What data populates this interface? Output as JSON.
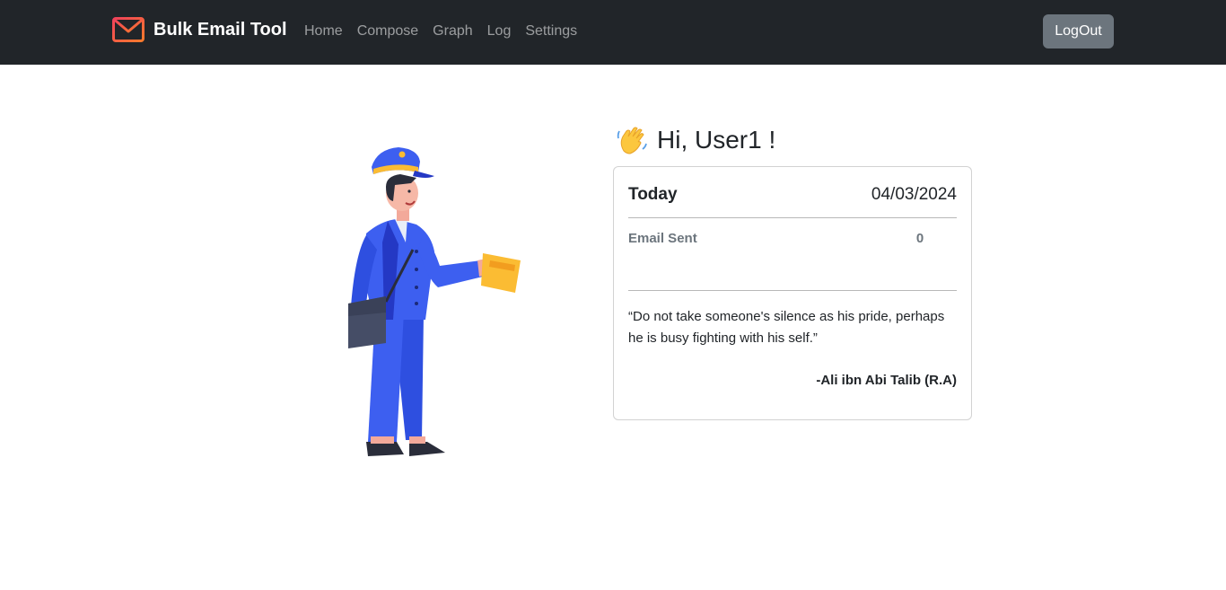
{
  "navbar": {
    "brand": "Bulk Email Tool",
    "brand_icon": "envelope-icon",
    "links": [
      {
        "label": "Home"
      },
      {
        "label": "Compose"
      },
      {
        "label": "Graph"
      },
      {
        "label": "Log"
      },
      {
        "label": "Settings"
      }
    ],
    "logout_label": "LogOut"
  },
  "greeting": {
    "icon": "waving-hand-icon",
    "text": "Hi, User1 !"
  },
  "stats_card": {
    "today_label": "Today",
    "today_date": "04/03/2024",
    "email_sent_label": "Email Sent",
    "email_sent_value": "0",
    "quote": "“Do not take someone's silence as his pride, perhaps he is busy fighting with his self.”",
    "quote_author": "-Ali ibn Abi Talib (R.A)"
  },
  "illustration": "mailman-illustration",
  "colors": {
    "navbar_bg": "#212529",
    "brand_icon": "#f1563f",
    "logout_bg": "#6c757d",
    "uniform_blue": "#3d5ff0",
    "envelope_yellow": "#fbbc33"
  }
}
